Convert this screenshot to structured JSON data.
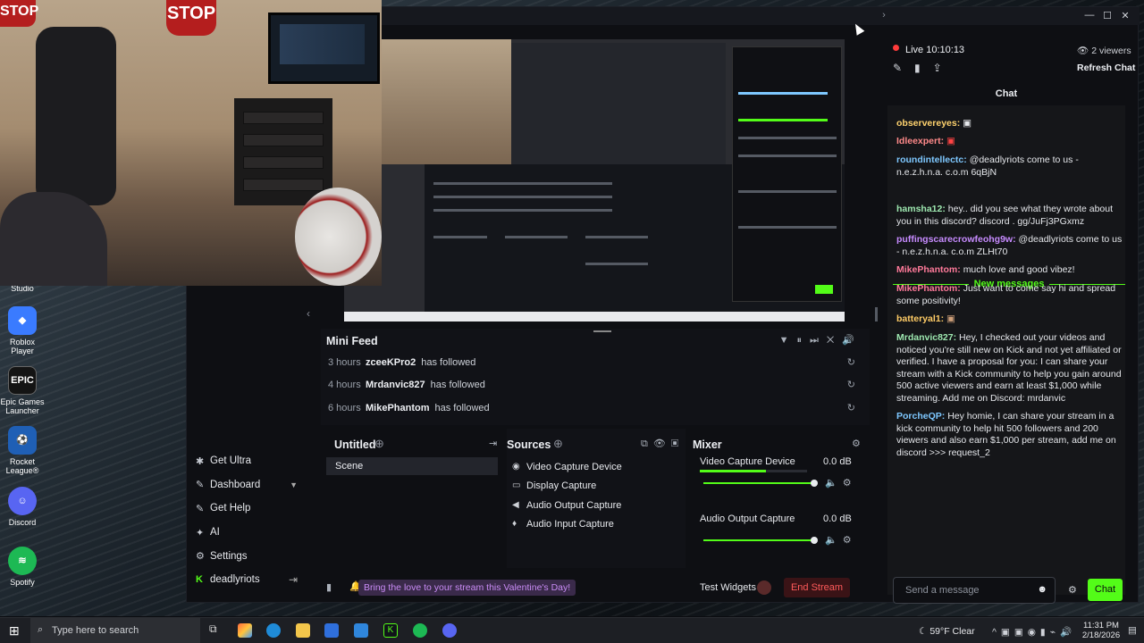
{
  "desktop": {
    "icons": [
      {
        "label": "Studio",
        "icon": "studio-icon",
        "color": "#2b2d33"
      },
      {
        "label": "Roblox Player",
        "icon": "roblox-icon",
        "color": "#3a7bff"
      },
      {
        "label": "Epic Games Launcher",
        "icon": "epic-games-icon",
        "color": "#141414"
      },
      {
        "label": "Rocket League®",
        "icon": "rocket-league-icon",
        "color": "#1f5fb5"
      },
      {
        "label": "Discord",
        "icon": "discord-icon",
        "color": "#5865f2"
      },
      {
        "label": "Spotify",
        "icon": "spotify-icon",
        "color": "#1db954"
      }
    ]
  },
  "webcam": {
    "stop_sign": "STOP",
    "stop_sign_2": "STOP"
  },
  "app": {
    "accent_color": "#53fc18",
    "sidebar": [
      {
        "label": "Get Ultra",
        "icon": "ultra-icon"
      },
      {
        "label": "Dashboard",
        "icon": "dashboard-icon"
      },
      {
        "label": "Get Help",
        "icon": "help-icon"
      },
      {
        "label": "AI",
        "icon": "ai-sparkle-icon"
      },
      {
        "label": "Settings",
        "icon": "gear-icon"
      },
      {
        "label": "deadlyriots",
        "icon": "kick-logo-icon"
      }
    ],
    "mini_feed": {
      "title": "Mini Feed",
      "rows": [
        {
          "time": "3 hours",
          "name": "zceeKPro2",
          "action": "has followed"
        },
        {
          "time": "4 hours",
          "name": "Mrdanvic827",
          "action": "has followed"
        },
        {
          "time": "6 hours",
          "name": "MikePhantom",
          "action": "has followed"
        }
      ]
    },
    "scenes": {
      "title": "Untitled",
      "items": [
        "Scene"
      ]
    },
    "sources": {
      "title": "Sources",
      "items": [
        {
          "label": "Video Capture Device",
          "icon": "webcam-icon"
        },
        {
          "label": "Display Capture",
          "icon": "monitor-icon"
        },
        {
          "label": "Audio Output Capture",
          "icon": "speaker-icon"
        },
        {
          "label": "Audio Input Capture",
          "icon": "microphone-icon"
        }
      ]
    },
    "mixer": {
      "title": "Mixer",
      "channels": [
        {
          "label": "Video Capture Device",
          "db": "0.0 dB",
          "level": 0.62
        },
        {
          "label": "Audio Output Capture",
          "db": "0.0 dB",
          "level": 0.0
        }
      ]
    },
    "bottom": {
      "banner": "Bring the love to your stream this Valentine's Day!",
      "test_widgets": "Test Widgets",
      "end_stream": "End Stream"
    },
    "stream": {
      "live_label": "Live 10:10:13",
      "viewers": "2 viewers",
      "refresh_chat": "Refresh Chat"
    },
    "chat": {
      "title": "Chat",
      "new_messages": "New messages",
      "messages_before": [
        {
          "user": "observereyes:",
          "color": "#ffd36e",
          "text": ""
        },
        {
          "user": "Idleexpert:",
          "color": "#ff8a8a",
          "text": ""
        },
        {
          "user": "roundintellectc:",
          "color": "#7ec8ff",
          "text": "@deadlyriots come to us - n.e.z.h.n.a. c.o.m 6qBjN"
        }
      ],
      "messages_after": [
        {
          "user": "hamsha12:",
          "color": "#9ee8b0",
          "text": "hey.. did you see what they wrote about you in this discord? discord . gg/JuFj3PGxmz"
        },
        {
          "user": "puffingscarecrowfeohg9w:",
          "color": "#c78bff",
          "text": "@deadlyriots come to us - n.e.z.h.n.a. c.o.m ZLHt70"
        },
        {
          "user": "MikePhantom:",
          "color": "#ff7a9a",
          "text": "much love and good vibez!"
        },
        {
          "user": "MikePhantom:",
          "color": "#ff7a9a",
          "text": "Just want to come say hi and spread some positivity!"
        },
        {
          "user": "batteryal1:",
          "color": "#ffcc66",
          "text": ""
        },
        {
          "user": "Mrdanvic827:",
          "color": "#9ee8b0",
          "text": "Hey, I checked out your videos and noticed you're still new on Kick and not yet affiliated or verified. I have a proposal for you: I can share your stream with a Kick community to help you gain around 500 active viewers and earn at least $1,000 while streaming. Add me on Discord: mrdanvic"
        },
        {
          "user": "PorcheQP:",
          "color": "#7ec8ff",
          "text": "Hey homie, I can share your stream in a kick community to help hit 500 followers and 200 viewers and also earn $1,000 per stream, add me on discord >>> request_2"
        }
      ],
      "input_placeholder": "Send a message",
      "send_label": "Chat"
    }
  },
  "taskbar": {
    "search_placeholder": "Type here to search",
    "weather": "59°F  Clear",
    "time": "11:31 PM",
    "date": "2/18/2026"
  }
}
